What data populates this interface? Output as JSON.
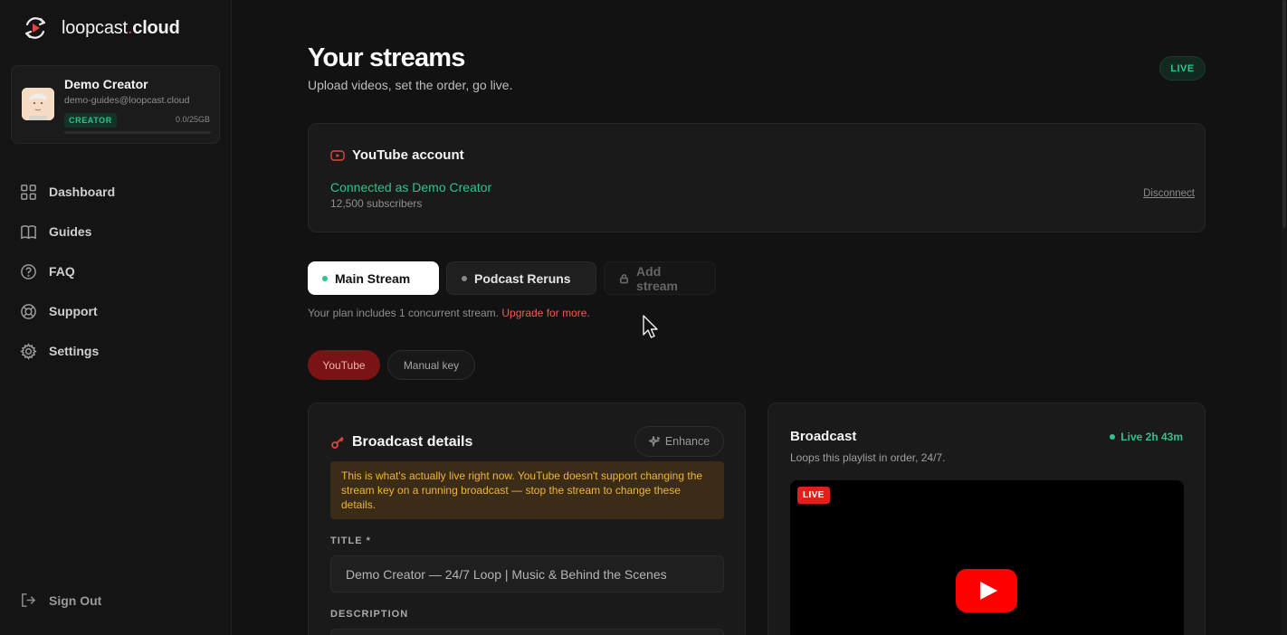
{
  "brand": {
    "name_light": "loopcast",
    "name_dot": ".",
    "name_bold": "cloud"
  },
  "profile": {
    "name": "Demo Creator",
    "email": "demo-guides@loopcast.cloud",
    "badge": "CREATOR",
    "storage": "0.0/25GB",
    "storage_fraction": 0.0
  },
  "nav": {
    "items": [
      {
        "label": "Dashboard",
        "icon": "grid-icon"
      },
      {
        "label": "Guides",
        "icon": "book-icon"
      },
      {
        "label": "FAQ",
        "icon": "help-circle-icon"
      },
      {
        "label": "Support",
        "icon": "lifebuoy-icon"
      },
      {
        "label": "Settings",
        "icon": "gear-icon"
      }
    ],
    "sign_out": "Sign Out"
  },
  "header": {
    "title": "Your streams",
    "subtitle": "Upload videos, set the order, go live.",
    "status": "LIVE"
  },
  "youtube_account": {
    "title": "YouTube account",
    "connected": "Connected as Demo Creator",
    "subscribers": "12,500 subscribers",
    "disconnect": "Disconnect"
  },
  "stream_tabs": {
    "main": "Main Stream",
    "podcast": "Podcast Reruns",
    "add": "Add stream",
    "plan_note": "Your plan includes 1 concurrent stream.",
    "upgrade": "Upgrade for more."
  },
  "mode": {
    "youtube": "YouTube",
    "manual": "Manual key"
  },
  "broadcast_details": {
    "title": "Broadcast details",
    "enhance": "Enhance",
    "warning": "This is what's actually live right now. YouTube doesn't support changing the stream key on a running broadcast — stop the stream to change these details.",
    "title_label": "TITLE *",
    "title_value": "Demo Creator — 24/7 Loop | Music & Behind the Scenes",
    "description_label": "DESCRIPTION"
  },
  "broadcast": {
    "title": "Broadcast",
    "subtitle": "Loops this playlist in order, 24/7.",
    "live_time": "Live 2h 43m",
    "player_badge": "LIVE"
  },
  "colors": {
    "accent_green": "#2fc48a",
    "accent_red": "#e0453e",
    "youtube_red": "#e0201b",
    "warning_text": "#f0b33d"
  }
}
